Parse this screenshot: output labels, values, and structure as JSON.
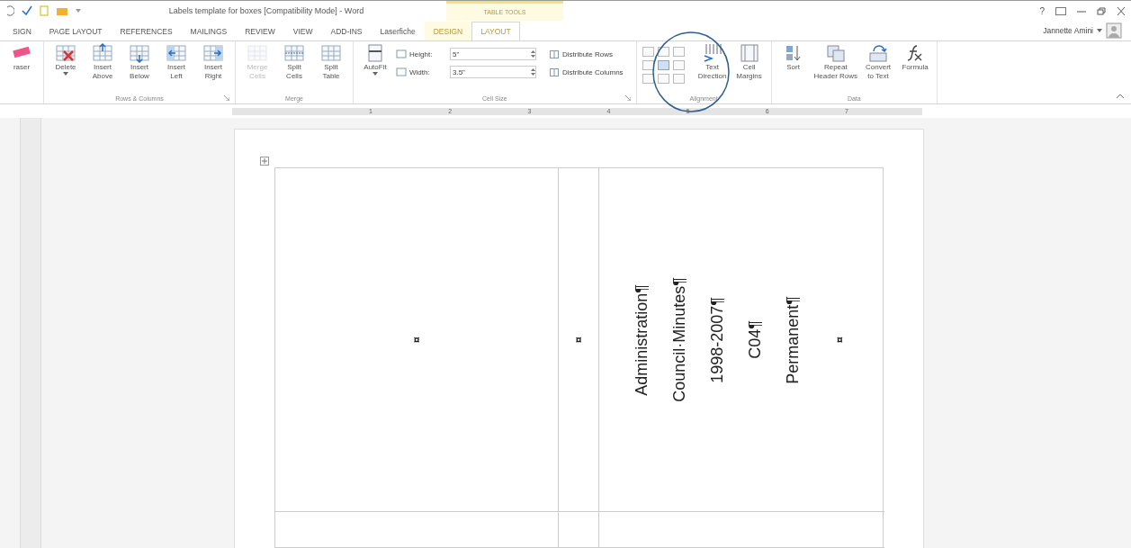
{
  "window": {
    "title": "Labels template for boxes [Compatibility Mode] - Word",
    "context_group": "TABLE TOOLS",
    "help": "?"
  },
  "tabs": [
    {
      "label": "SIGN",
      "selected": false,
      "contextual": false
    },
    {
      "label": "PAGE LAYOUT",
      "selected": false,
      "contextual": false
    },
    {
      "label": "REFERENCES",
      "selected": false,
      "contextual": false
    },
    {
      "label": "MAILINGS",
      "selected": false,
      "contextual": false
    },
    {
      "label": "REVIEW",
      "selected": false,
      "contextual": false
    },
    {
      "label": "VIEW",
      "selected": false,
      "contextual": false
    },
    {
      "label": "ADD-INS",
      "selected": false,
      "contextual": false
    },
    {
      "label": "Laserfiche",
      "selected": false,
      "contextual": false
    },
    {
      "label": "DESIGN",
      "selected": false,
      "contextual": true
    },
    {
      "label": "LAYOUT",
      "selected": true,
      "contextual": true
    }
  ],
  "user": {
    "name": "Jannette Amini"
  },
  "ribbon": {
    "groups": [
      {
        "kind": "buttons",
        "launcher": false,
        "items": [
          {
            "kind": "eraser",
            "lines": [
              "raser"
            ],
            "disabled": false,
            "dropdown": false
          }
        ]
      },
      {
        "kind": "buttons",
        "label": "Rows & Columns",
        "launcher": true,
        "items": [
          {
            "kind": "delete",
            "lines": [
              "Delete"
            ],
            "disabled": false,
            "dropdown": true
          },
          {
            "kind": "insert-above",
            "lines": [
              "Insert",
              "Above"
            ],
            "disabled": false,
            "dropdown": false
          },
          {
            "kind": "insert-below",
            "lines": [
              "Insert",
              "Below"
            ],
            "disabled": false,
            "dropdown": false
          },
          {
            "kind": "insert-left",
            "lines": [
              "Insert",
              "Left"
            ],
            "disabled": false,
            "dropdown": false
          },
          {
            "kind": "insert-right",
            "lines": [
              "Insert",
              "Right"
            ],
            "disabled": false,
            "dropdown": false
          }
        ]
      },
      {
        "kind": "buttons",
        "label": "Merge",
        "launcher": false,
        "items": [
          {
            "kind": "merge",
            "lines": [
              "Merge",
              "Cells"
            ],
            "disabled": true,
            "dropdown": false
          },
          {
            "kind": "split-cells",
            "lines": [
              "Split",
              "Cells"
            ],
            "disabled": false,
            "dropdown": false
          },
          {
            "kind": "split-table",
            "lines": [
              "Split",
              "Table"
            ],
            "disabled": false,
            "dropdown": false
          }
        ]
      },
      {
        "kind": "cell-size",
        "label": "Cell Size",
        "launcher": true,
        "autofit": {
          "kind": "autofit",
          "lines": [
            "AutoFit"
          ],
          "disabled": false,
          "dropdown": true
        },
        "fields": [
          {
            "label": "Height:",
            "value": "5\""
          },
          {
            "label": "Width:",
            "value": "3.5\""
          }
        ],
        "commands": [
          "Distribute Rows",
          "Distribute Columns"
        ]
      },
      {
        "kind": "alignment",
        "label": "Alignment",
        "launcher": false,
        "cells": [
          {
            "selected": false
          },
          {
            "selected": false
          },
          {
            "selected": false
          },
          {
            "selected": false
          },
          {
            "selected": true
          },
          {
            "selected": false
          },
          {
            "selected": false
          },
          {
            "selected": false
          },
          {
            "selected": false
          }
        ],
        "items": [
          {
            "kind": "text-direction",
            "lines": [
              "Text",
              "Direction"
            ],
            "disabled": false,
            "dropdown": false
          },
          {
            "kind": "cell-margins",
            "lines": [
              "Cell",
              "Margins"
            ],
            "disabled": false,
            "dropdown": false
          }
        ]
      },
      {
        "kind": "buttons",
        "label": "Data",
        "launcher": false,
        "items": [
          {
            "kind": "sort",
            "lines": [
              "Sort"
            ],
            "disabled": false,
            "dropdown": false
          },
          {
            "kind": "repeat-header",
            "lines": [
              "Repeat",
              "Header Rows"
            ],
            "disabled": false,
            "dropdown": false
          },
          {
            "kind": "convert",
            "lines": [
              "Convert",
              "to Text"
            ],
            "disabled": false,
            "dropdown": false
          },
          {
            "kind": "formula",
            "lines": [
              "Formula"
            ],
            "disabled": false,
            "dropdown": false
          }
        ]
      }
    ]
  },
  "ruler": {
    "numbers": [
      "1",
      "2",
      "3",
      "4",
      "5",
      "6",
      "7"
    ]
  },
  "table": {
    "row": {
      "cells": [
        {
          "end_mark": "¤"
        },
        {
          "end_mark": "¤"
        },
        {
          "lines": [
            "Administration¶",
            "Council·Minutes¶",
            "1998-2007¶",
            "C04¶",
            "Permanent¶"
          ],
          "end_mark": "¤"
        }
      ]
    }
  }
}
